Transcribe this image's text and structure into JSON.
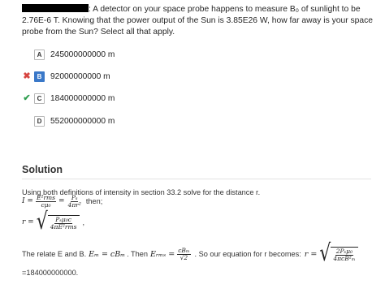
{
  "question": {
    "text": ": A detector on your space probe happens to measure B₀ of sunlight to be 2.76E-6 T. Knowing that the power output of the Sun is 3.85E26 W, how far away is your space probe from the Sun? Select all that apply."
  },
  "options": [
    {
      "letter": "A",
      "value": "245000000000 m",
      "mark": "",
      "selected": false
    },
    {
      "letter": "B",
      "value": "92000000000 m",
      "mark": "✖",
      "selected": true
    },
    {
      "letter": "C",
      "value": "184000000000 m",
      "mark": "✔",
      "selected": false
    },
    {
      "letter": "D",
      "value": "552000000000 m",
      "mark": "",
      "selected": false
    }
  ],
  "solution": {
    "title": "Solution",
    "line1": "Using both definitions of intensity in section 33.2 solve for the distance r.",
    "eq1_lhs": "I =",
    "eq1_f1_num": "E²rms",
    "eq1_f1_den": "cμ₀",
    "eq1_eq": "=",
    "eq1_f2_num": "Pₛ",
    "eq1_f2_den": "4πr²",
    "eq1_after": "then;",
    "eq2_lhs": "r =",
    "eq2_num": "Pₛμ₀c",
    "eq2_den": "4πE²rms",
    "eq2_after": ",",
    "line3_a": "The relate E and B.",
    "line3_em": "Eₘ = cBₘ",
    "line3_b": ". Then",
    "line3_erms": "Eᵣₘₛ =",
    "line3_f_num": "cBₘ",
    "line3_f_den": "√2",
    "line3_c": ". So our equation for r becomes:",
    "line3_r": "r =",
    "line3_rnum": "2Pₛμ₀",
    "line3_rden": "4πcB²ₘ",
    "result": "=184000000000."
  }
}
